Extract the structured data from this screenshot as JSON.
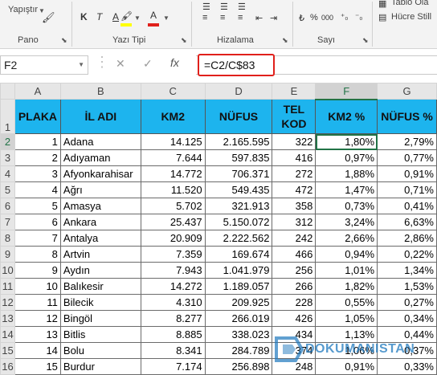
{
  "ribbon": {
    "clipboard_partial": "Yapıştır",
    "group_pano": "Pano",
    "group_font": "Yazı Tipi",
    "group_align": "Hizalama",
    "group_number": "Sayı",
    "table_partial": "Tablo Ola",
    "cell_styles_partial": "Hücre Still",
    "bold": "K",
    "italic": "T",
    "underline": "A",
    "font_color_glyph": "A",
    "highlight_color": "#ffff00",
    "font_color": "#e0201b",
    "percent": "%",
    "thousands": "000"
  },
  "formula_bar": {
    "name_box": "F2",
    "formula": "=C2/C$83"
  },
  "columns": [
    "A",
    "B",
    "C",
    "D",
    "E",
    "F",
    "G"
  ],
  "selected_column": "F",
  "header_row": {
    "row": "1",
    "cells": [
      "PLAKA",
      "İL ADI",
      "KM2",
      "NÜFUS",
      "TEL KOD",
      "KM2 %",
      "NÜFUS %"
    ]
  },
  "rows": [
    {
      "row": "2",
      "plaka": "1",
      "il": "Adana",
      "km2": "14.125",
      "nufus": "2.165.595",
      "tel": "322",
      "km2p": "1,80%",
      "nufusp": "2,79%"
    },
    {
      "row": "3",
      "plaka": "2",
      "il": "Adıyaman",
      "km2": "7.644",
      "nufus": "597.835",
      "tel": "416",
      "km2p": "0,97%",
      "nufusp": "0,77%"
    },
    {
      "row": "4",
      "plaka": "3",
      "il": "Afyonkarahisar",
      "km2": "14.772",
      "nufus": "706.371",
      "tel": "272",
      "km2p": "1,88%",
      "nufusp": "0,91%"
    },
    {
      "row": "5",
      "plaka": "4",
      "il": "Ağrı",
      "km2": "11.520",
      "nufus": "549.435",
      "tel": "472",
      "km2p": "1,47%",
      "nufusp": "0,71%"
    },
    {
      "row": "6",
      "plaka": "5",
      "il": "Amasya",
      "km2": "5.702",
      "nufus": "321.913",
      "tel": "358",
      "km2p": "0,73%",
      "nufusp": "0,41%"
    },
    {
      "row": "7",
      "plaka": "6",
      "il": "Ankara",
      "km2": "25.437",
      "nufus": "5.150.072",
      "tel": "312",
      "km2p": "3,24%",
      "nufusp": "6,63%"
    },
    {
      "row": "8",
      "plaka": "7",
      "il": "Antalya",
      "km2": "20.909",
      "nufus": "2.222.562",
      "tel": "242",
      "km2p": "2,66%",
      "nufusp": "2,86%"
    },
    {
      "row": "9",
      "plaka": "8",
      "il": "Artvin",
      "km2": "7.359",
      "nufus": "169.674",
      "tel": "466",
      "km2p": "0,94%",
      "nufusp": "0,22%"
    },
    {
      "row": "10",
      "plaka": "9",
      "il": "Aydın",
      "km2": "7.943",
      "nufus": "1.041.979",
      "tel": "256",
      "km2p": "1,01%",
      "nufusp": "1,34%"
    },
    {
      "row": "11",
      "plaka": "10",
      "il": "Balıkesir",
      "km2": "14.272",
      "nufus": "1.189.057",
      "tel": "266",
      "km2p": "1,82%",
      "nufusp": "1,53%"
    },
    {
      "row": "12",
      "plaka": "11",
      "il": "Bilecik",
      "km2": "4.310",
      "nufus": "209.925",
      "tel": "228",
      "km2p": "0,55%",
      "nufusp": "0,27%"
    },
    {
      "row": "13",
      "plaka": "12",
      "il": "Bingöl",
      "km2": "8.277",
      "nufus": "266.019",
      "tel": "426",
      "km2p": "1,05%",
      "nufusp": "0,34%"
    },
    {
      "row": "14",
      "plaka": "13",
      "il": "Bitlis",
      "km2": "8.885",
      "nufus": "338.023",
      "tel": "434",
      "km2p": "1,13%",
      "nufusp": "0,44%"
    },
    {
      "row": "15",
      "plaka": "14",
      "il": "Bolu",
      "km2": "8.341",
      "nufus": "284.789",
      "tel": "374",
      "km2p": "1,06%",
      "nufusp": "0,37%"
    },
    {
      "row": "16",
      "plaka": "15",
      "il": "Burdur",
      "km2": "7.174",
      "nufus": "256.898",
      "tel": "248",
      "km2p": "0,91%",
      "nufusp": "0,33%"
    }
  ],
  "watermark": {
    "text": "DOKUMANISTAN",
    "logo": "dokumanistan-logo"
  }
}
